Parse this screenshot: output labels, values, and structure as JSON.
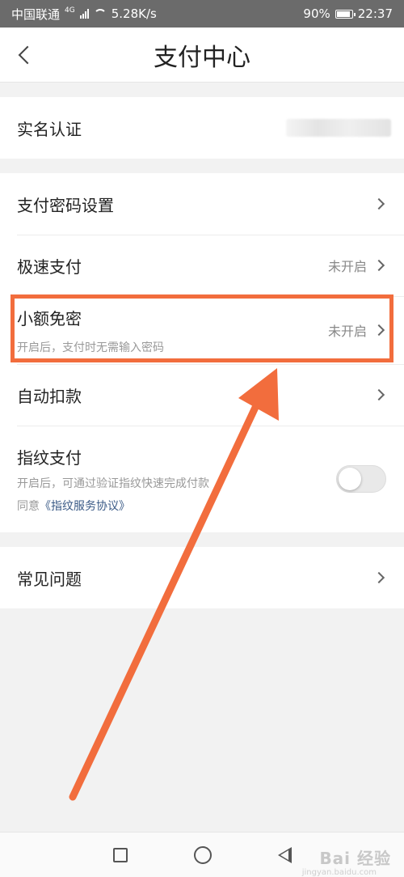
{
  "status_bar": {
    "carrier": "中国联通",
    "network": "4G",
    "speed": "5.28K/s",
    "battery": "90%",
    "time": "22:37"
  },
  "nav": {
    "title": "支付中心",
    "back_icon": "chevron-left-icon"
  },
  "rows": {
    "real_name": {
      "label": "实名认证"
    },
    "pay_password": {
      "label": "支付密码设置"
    },
    "fast_pay": {
      "label": "极速支付",
      "status": "未开启"
    },
    "small_free": {
      "label": "小额免密",
      "sub": "开启后，支付时无需输入密码",
      "status": "未开启"
    },
    "auto_debit": {
      "label": "自动扣款"
    },
    "fingerprint": {
      "label": "指纹支付",
      "sub": "开启后，可通过验证指纹快速完成付款",
      "agree_prefix": "同意",
      "agree_link": "《指纹服务协议》",
      "toggle_on": false
    },
    "faq": {
      "label": "常见问题"
    }
  },
  "annotation": {
    "color": "#f26d3d"
  },
  "bottom_nav": {
    "icons": [
      "square-icon",
      "circle-icon",
      "triangle-back-icon"
    ]
  },
  "watermark": {
    "text": "Bai 经验",
    "sub": "jingyan.baidu.com"
  }
}
